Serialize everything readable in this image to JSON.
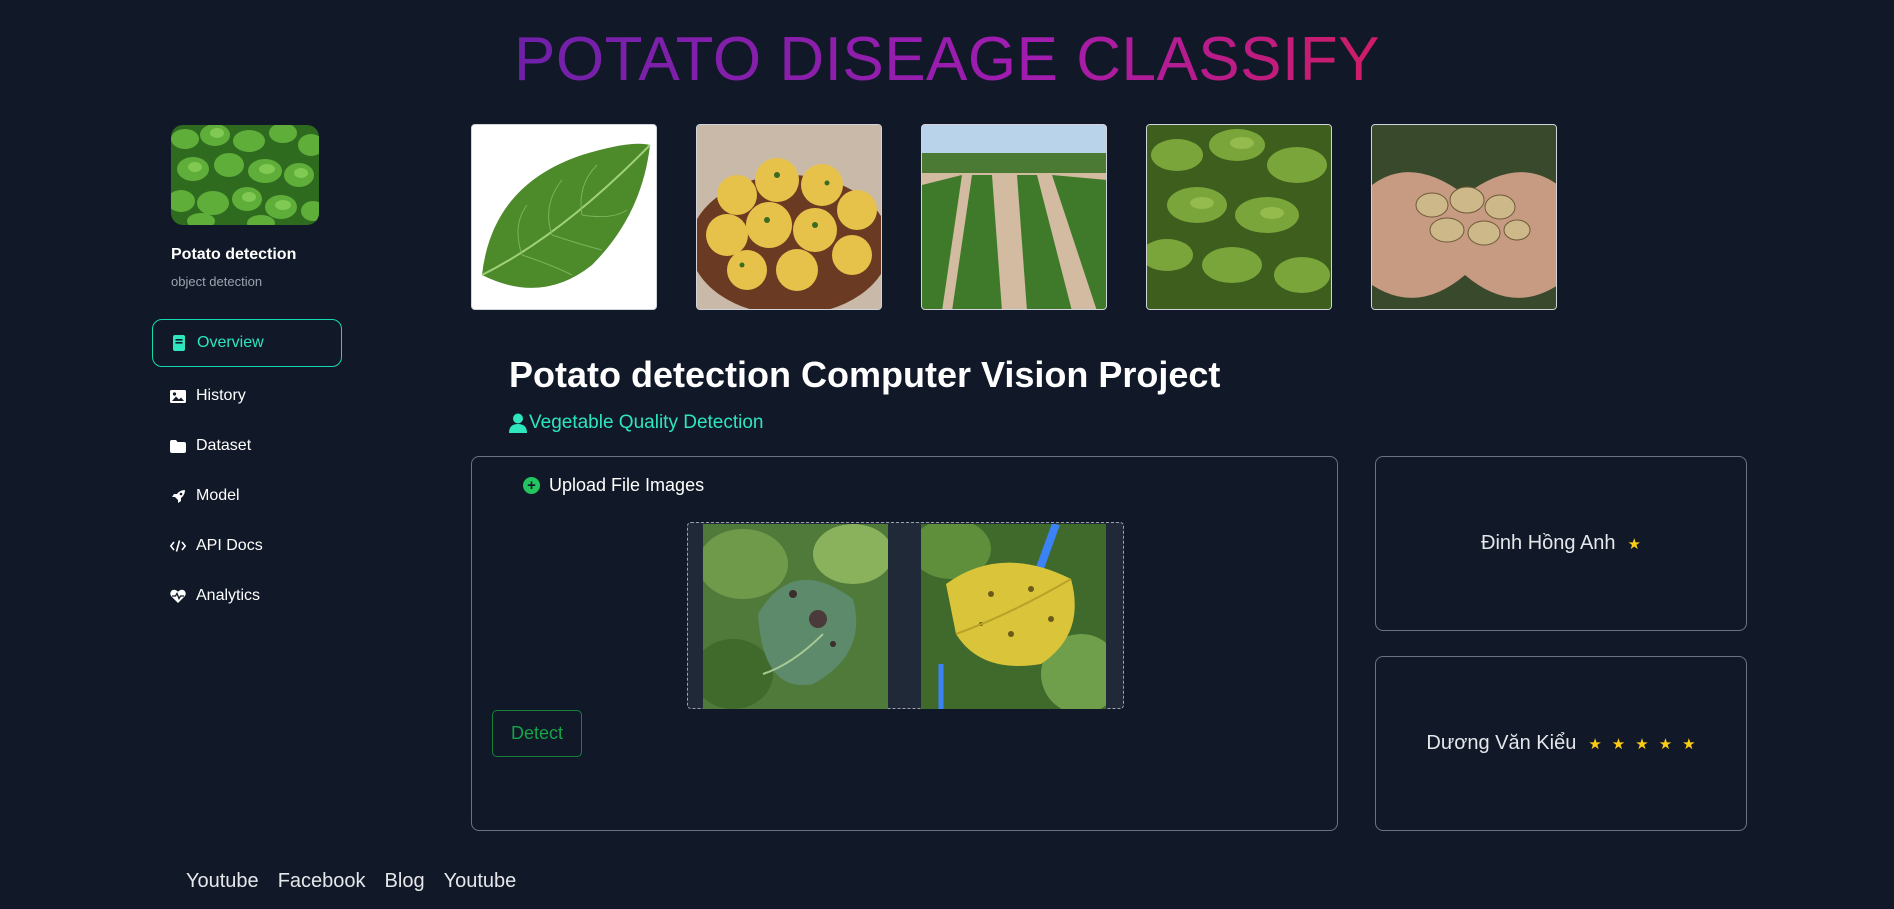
{
  "header": {
    "title": "POTATO DISEAGE CLASSIFY"
  },
  "sidebar": {
    "project_name": "Potato detection",
    "project_sub": "object detection",
    "items": [
      {
        "label": "Overview",
        "icon": "book-icon",
        "active": true
      },
      {
        "label": "History",
        "icon": "image-icon"
      },
      {
        "label": "Dataset",
        "icon": "folder-icon"
      },
      {
        "label": "Model",
        "icon": "rocket-icon"
      },
      {
        "label": "API Docs",
        "icon": "code-icon"
      },
      {
        "label": "Analytics",
        "icon": "heart-pulse-icon"
      }
    ]
  },
  "main": {
    "title": "Potato detection Computer Vision Project",
    "subtitle": "Vegetable Quality Detection",
    "upload_label": "Upload File Images",
    "detect_label": "Detect"
  },
  "ratings": [
    {
      "name": "Đinh Hồng Anh",
      "stars": 1
    },
    {
      "name": "Dương Văn Kiểu",
      "stars": 5
    }
  ],
  "footer": {
    "links": [
      "Youtube",
      "Facebook",
      "Blog",
      "Youtube"
    ]
  },
  "colors": {
    "accent": "#2ee6c0",
    "background": "#111827",
    "star": "#facc15",
    "detect": "#16a34a"
  }
}
